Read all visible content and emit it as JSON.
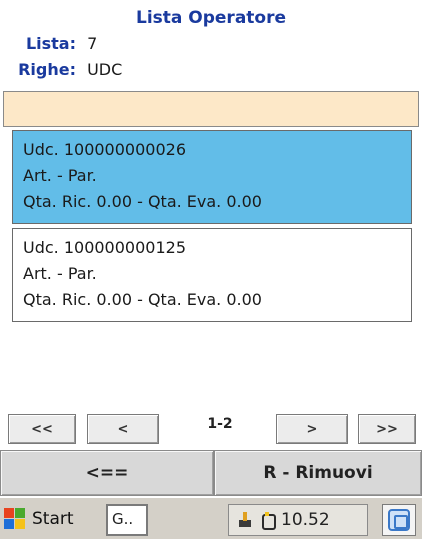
{
  "header": {
    "title": "Lista Operatore",
    "lista_label": "Lista:",
    "lista_value": "7",
    "righe_label": "Righe:",
    "righe_value": "UDC"
  },
  "input": {
    "value": ""
  },
  "list": {
    "items": [
      {
        "udc": "Udc. 100000000026",
        "art": "Art.  - Par.",
        "qta": "Qta. Ric. 0.00 - Qta. Eva. 0.00",
        "selected": true
      },
      {
        "udc": "Udc. 100000000125",
        "art": "Art.  - Par.",
        "qta": "Qta. Ric. 0.00 - Qta. Eva. 0.00",
        "selected": false
      }
    ]
  },
  "pager": {
    "first_label": "<<",
    "prev_label": "<",
    "page_indicator": "1-2",
    "next_label": ">",
    "last_label": ">>"
  },
  "actions": {
    "back_label": "<==",
    "remove_label": "R - Rimuovi"
  },
  "taskbar": {
    "start_label": "Start",
    "task_label": "G..",
    "clock": "10.52"
  },
  "colors": {
    "title": "#1a3a9e",
    "selected_row": "#62bde8",
    "input_band": "#fde8c8"
  }
}
